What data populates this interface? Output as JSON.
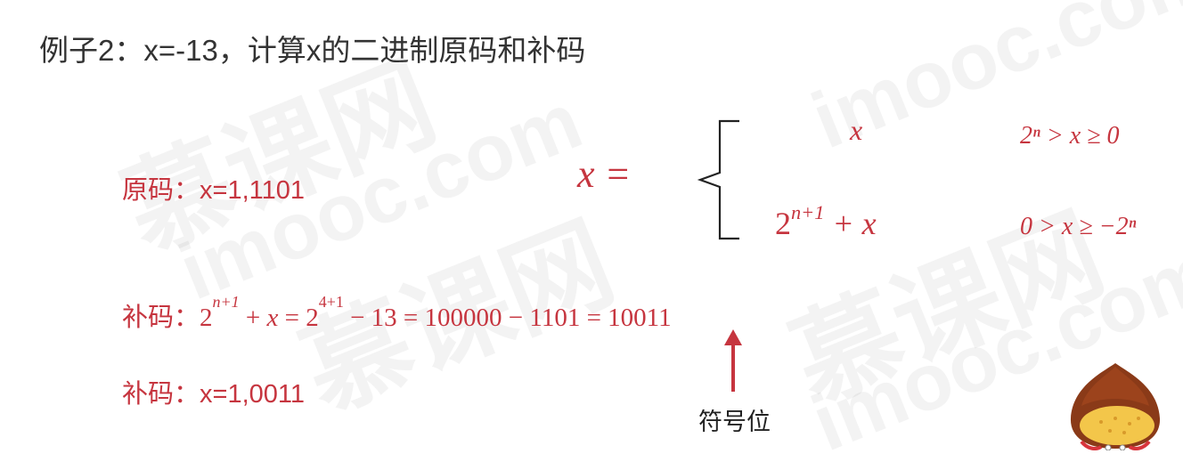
{
  "title": "例子2：x=-13，计算x的二进制原码和补码",
  "original_code": {
    "label": "原码：",
    "value": "x=1,1101"
  },
  "complement_formula": {
    "label": "补码：",
    "lhs": "2",
    "exp1": "n+1",
    "op1": " + ",
    "x": "x",
    "eq1": " = ",
    "base2": "2",
    "exp2": "4+1",
    "rest": " − 13 = 100000 − 1101 = 10011"
  },
  "complement_result": {
    "label": "补码：",
    "value": "x=1,0011"
  },
  "sign_bit_label": "符号位",
  "piecewise": {
    "lhs": "x =",
    "case1_expr": "x",
    "case1_cond": "2ⁿ > x ≥ 0",
    "case2_base": "2",
    "case2_exp": "n+1",
    "case2_rest": " + x",
    "case2_cond": "0 > x ≥ −2ⁿ"
  },
  "watermark": {
    "brand_cn": "慕课网",
    "brand_en": "imooc.com"
  },
  "colors": {
    "accent": "#c6353f",
    "title": "#333333",
    "mascot_shell": "#8a3a18",
    "mascot_face": "#f3c64a"
  }
}
